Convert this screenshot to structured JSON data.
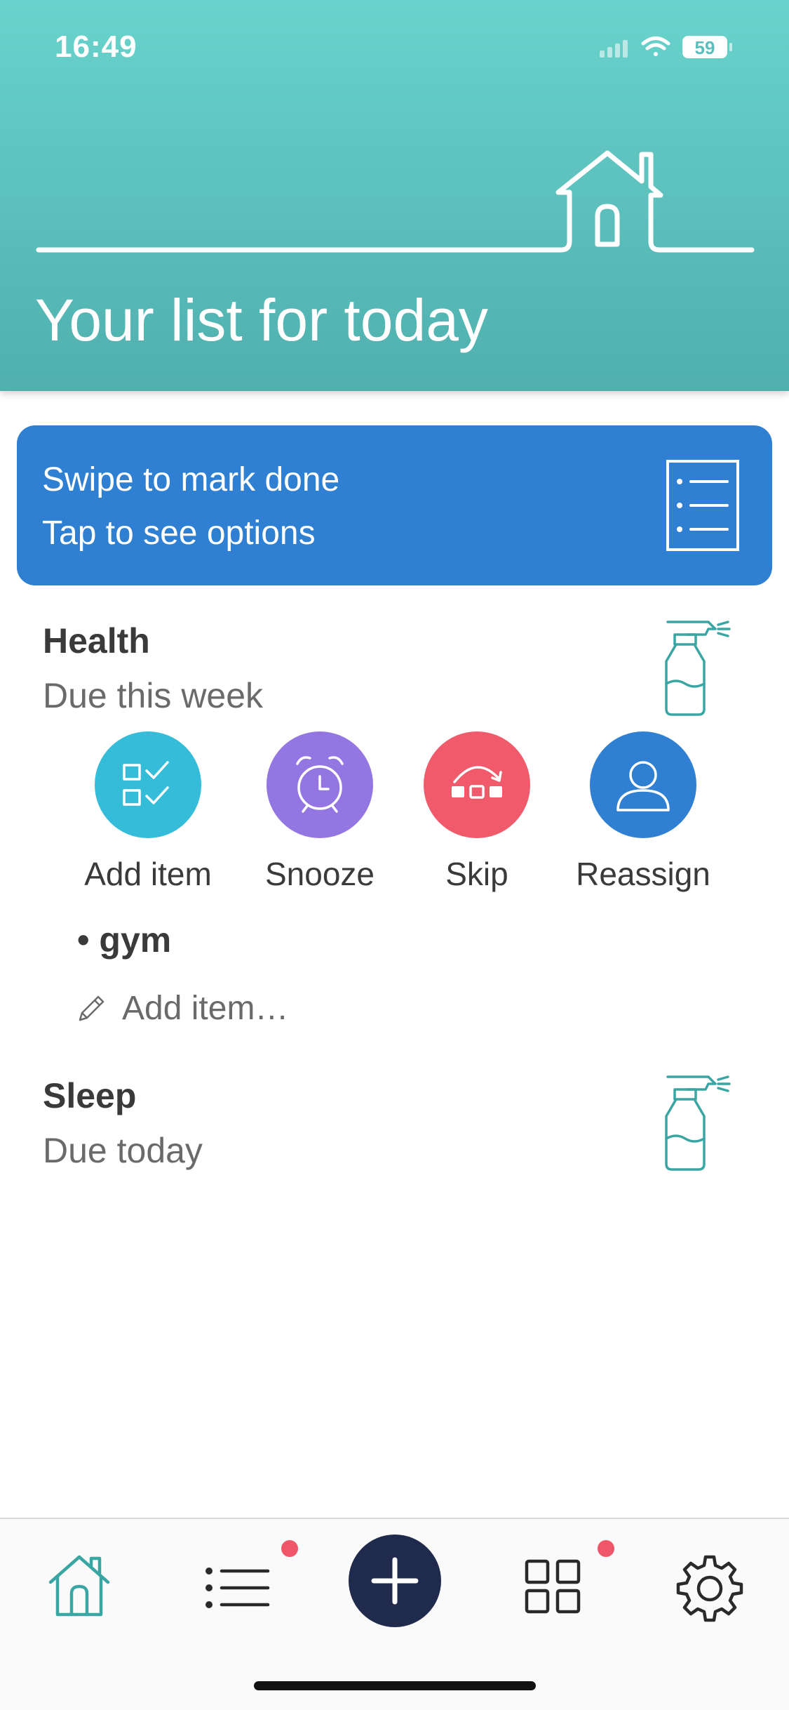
{
  "status_bar": {
    "time": "16:49",
    "battery": "59"
  },
  "header": {
    "title": "Your list for today"
  },
  "banner": {
    "line1": "Swipe to mark done",
    "line2": "Tap to see options"
  },
  "sections": [
    {
      "title": "Health",
      "subtitle": "Due this week"
    },
    {
      "title": "Sleep",
      "subtitle": "Due today"
    }
  ],
  "actions": [
    {
      "label": "Add item",
      "color": "#35bcd9",
      "icon": "checklist-icon"
    },
    {
      "label": "Snooze",
      "color": "#9476e2",
      "icon": "alarm-clock-icon"
    },
    {
      "label": "Skip",
      "color": "#f05a6b",
      "icon": "skip-icon"
    },
    {
      "label": "Reassign",
      "color": "#2f7fd2",
      "icon": "person-icon"
    }
  ],
  "items": [
    {
      "label": "gym"
    }
  ],
  "add_item_placeholder": "Add item…",
  "tabbar": {
    "items": [
      "home-icon",
      "list-icon",
      "add-icon",
      "grid-icon",
      "settings-icon"
    ],
    "badge_color": "#f0566a"
  }
}
